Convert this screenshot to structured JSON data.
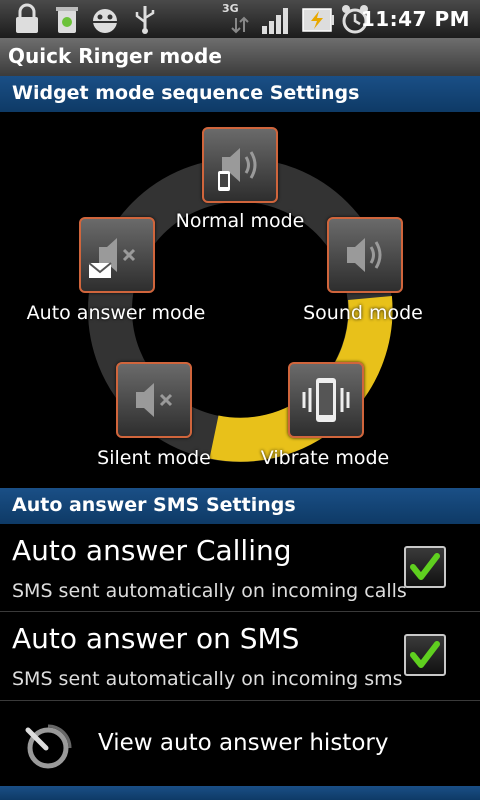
{
  "status_bar": {
    "time": "11:47 PM",
    "network": "3G"
  },
  "title_bar": {
    "title": "Quick Ringer mode"
  },
  "mode_section": {
    "header": "Widget mode sequence Settings",
    "modes": [
      {
        "label": "Normal mode",
        "icon": "normal-mode-icon"
      },
      {
        "label": "Sound mode",
        "icon": "sound-mode-icon"
      },
      {
        "label": "Vibrate mode",
        "icon": "vibrate-mode-icon"
      },
      {
        "label": "Silent mode",
        "icon": "silent-mode-icon"
      },
      {
        "label": "Auto answer mode",
        "icon": "auto-answer-mode-icon"
      }
    ],
    "ring_color": "#333333",
    "ring_accent": "#e8c11a"
  },
  "sms_section": {
    "header": "Auto answer SMS Settings",
    "items": [
      {
        "title": "Auto answer Calling",
        "subtitle": "SMS sent automatically on incoming calls",
        "checked": true
      },
      {
        "title": "Auto answer on SMS",
        "subtitle": "SMS sent automatically on incoming sms",
        "checked": true
      }
    ],
    "history_label": "View auto answer history"
  },
  "colors": {
    "section_header": "#164a80",
    "mode_border": "#d0653c",
    "check_green": "#5fcf1f"
  }
}
